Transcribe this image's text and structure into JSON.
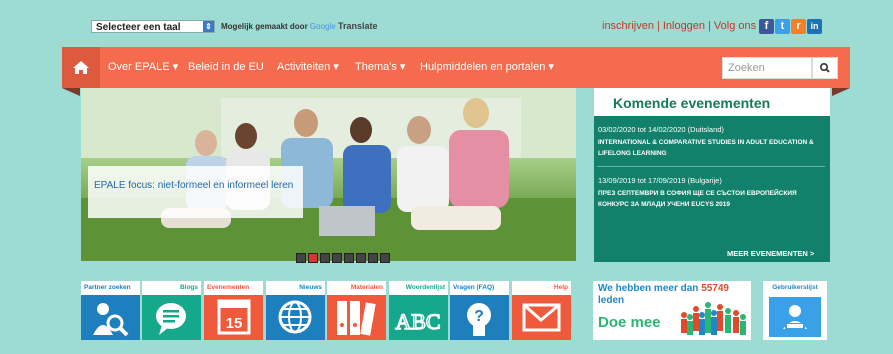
{
  "header": {
    "language_select": "Selecteer een taal",
    "powered_by": "Mogelijk gemaakt door",
    "google": "Google",
    "translate": "Translate",
    "register": "inschrijven",
    "login": "Inloggen",
    "follow": "Volg ons op",
    "separator": "|",
    "social": [
      {
        "name": "facebook-icon",
        "glyph": "f",
        "color": "#3b5998"
      },
      {
        "name": "twitter-icon",
        "glyph": "t",
        "color": "#3aa0e8"
      },
      {
        "name": "rss-icon",
        "glyph": "r",
        "color": "#f5802a"
      },
      {
        "name": "linkedin-icon",
        "glyph": "in",
        "color": "#1a74b3"
      }
    ]
  },
  "nav": {
    "items": [
      "Over EPALE",
      "Beleid in de EU",
      "Activiteiten",
      "Thema's",
      "Hulpmiddelen en portalen"
    ],
    "has_caret": [
      true,
      false,
      true,
      true,
      true
    ],
    "search_placeholder": "Zoeken"
  },
  "hero": {
    "caption": "EPALE focus: niet-formeel en informeel leren",
    "slides": 8,
    "active_slide": 2
  },
  "events": {
    "title": "Komende evenementen",
    "items": [
      {
        "date": "03/02/2020 tot 14/02/2020 (Duitsland)",
        "title": "INTERNATIONAL & COMPARATIVE STUDIES IN ADULT EDUCATION & LIFELONG LEARNING"
      },
      {
        "date": "13/09/2019 tot 17/09/2019 (Bulgarije)",
        "title": "ПРЕЗ СЕПТЕМВРИ В СОФИЯ ЩЕ СЕ СЪСТОИ ЕВРОПЕЙСКИЯ КОНКУРС ЗА МЛАДИ УЧЕНИ EUCYS 2019"
      }
    ],
    "more": "MEER EVENEMENTEN >"
  },
  "tiles": [
    {
      "label": "Partner zoeken",
      "color": "#1e7fbf",
      "align": "left",
      "icon": "partner-search-icon"
    },
    {
      "label": "Blogs",
      "color": "#15a88c",
      "align": "right",
      "icon": "chat-bubble-icon"
    },
    {
      "label": "Evenementen",
      "color": "#f05a3c",
      "align": "left",
      "icon": "calendar-icon",
      "day": "15"
    },
    {
      "label": "Nieuws",
      "color": "#1e7fbf",
      "align": "right",
      "icon": "globe-icon"
    },
    {
      "label": "Materialen",
      "color": "#f05a3c",
      "align": "right",
      "icon": "binders-icon"
    },
    {
      "label": "Woordenlijst",
      "color": "#15a88c",
      "align": "right",
      "icon": "abc-icon",
      "letters": "ABC"
    },
    {
      "label": "Vragen (FAQ)",
      "color": "#1e7fbf",
      "align": "left",
      "icon": "question-icon",
      "glyph": "?"
    },
    {
      "label": "Help",
      "color": "#f05a3c",
      "align": "right",
      "icon": "envelope-icon"
    }
  ],
  "promo": {
    "prefix": "We hebben meer dan",
    "count": "55749",
    "suffix": "leden",
    "cta": "Doe mee"
  },
  "users": {
    "label": "Gebruikerslijst"
  }
}
